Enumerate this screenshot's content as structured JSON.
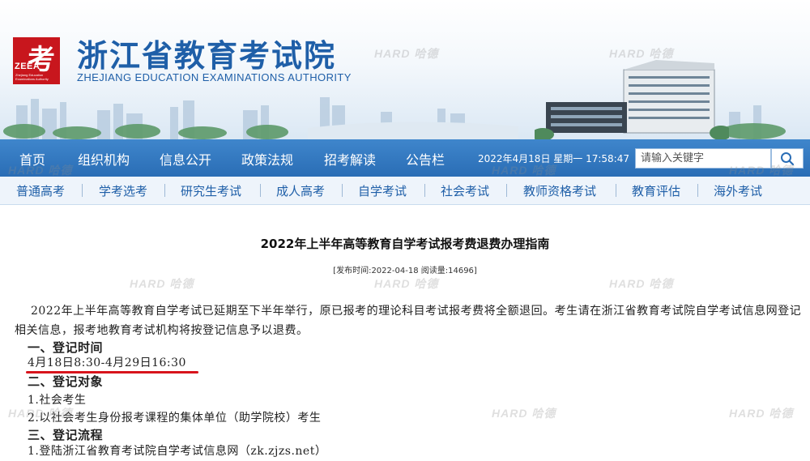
{
  "header": {
    "logo_glyph": "考",
    "logo_abbr": "ZEEA",
    "logo_subtext": "Zhejiang Education Examinations Authority",
    "site_title": "浙江省教育考试院",
    "site_title_en": "ZHEJIANG EDUCATION EXAMINATIONS AUTHORITY"
  },
  "main_nav": {
    "items": [
      {
        "label": "首页"
      },
      {
        "label": "组织机构"
      },
      {
        "label": "信息公开"
      },
      {
        "label": "政策法规"
      },
      {
        "label": "招考解读"
      },
      {
        "label": "公告栏"
      }
    ],
    "datetime": "2022年4月18日 星期一 17:58:47",
    "search_placeholder": "请输入关键字",
    "search_icon": "search-icon"
  },
  "sub_nav": {
    "items": [
      {
        "label": "普通高考"
      },
      {
        "label": "学考选考"
      },
      {
        "label": "研究生考试"
      },
      {
        "label": "成人高考"
      },
      {
        "label": "自学考试"
      },
      {
        "label": "社会考试"
      },
      {
        "label": "教师资格考试"
      },
      {
        "label": "教育评估"
      },
      {
        "label": "海外考试"
      }
    ]
  },
  "article": {
    "title": "2022年上半年高等教育自学考试报考费退费办理指南",
    "meta": "[发布时间:2022-04-18 阅读量:14696]",
    "intro": "2022年上半年高等教育自学考试已延期至下半年举行，原已报考的理论科目考试报考费将全额退回。考生请在浙江省教育考试院自学考试信息网登记相关信息，报考地教育考试机构将按登记信息予以退费。",
    "sections": [
      {
        "heading": "一、登记时间",
        "lines": [
          "4月18日8:30-4月29日16:30"
        ]
      },
      {
        "heading": "二、登记对象",
        "lines": [
          "1.社会考生",
          "2.以社会考生身份报考课程的集体单位（助学院校）考生"
        ]
      },
      {
        "heading": "三、登记流程",
        "lines": [
          "1.登陆浙江省教育考试院自学考试信息网（zk.zjzs.net）"
        ]
      }
    ]
  },
  "watermark": {
    "text": "HARD 哈德"
  },
  "colors": {
    "brand_blue": "#1f5fa8",
    "nav_blue": "#2a6db5",
    "logo_red": "#c8161d",
    "highlight_red": "#d8141c"
  }
}
